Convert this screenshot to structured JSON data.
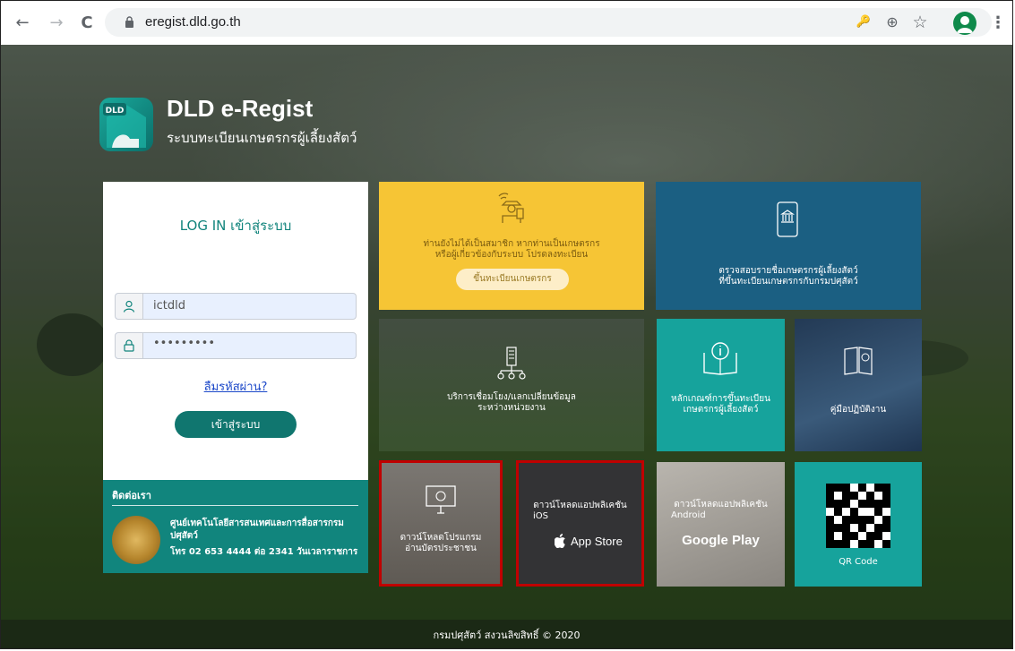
{
  "browser": {
    "url": "eregist.dld.go.th",
    "back_icon": "←",
    "forward_icon": "→",
    "reload_icon": "C",
    "key_icon": "🔑",
    "zoom_icon": "⊕",
    "star_icon": "☆",
    "menu_icon": "⋮"
  },
  "brand": {
    "title": "DLD e-Regist",
    "subtitle": "ระบบทะเบียนเกษตรกรผู้เลี้ยงสัตว์",
    "logo_text": "DLD"
  },
  "login": {
    "title": "LOG IN เข้าสู่ระบบ",
    "username_value": "ictdld",
    "password_value": "•••••••••",
    "forgot_label": "ลืมรหัสผ่าน?",
    "submit_label": "เข้าสู่ระบบ"
  },
  "contact": {
    "title": "ติดต่อเรา",
    "org": "ศูนย์เทคโนโลยีสารสนเทศและการสื่อสารกรมปศุสัตว์",
    "tel": "โทร 02 653 4444 ต่อ 2341 วันเวลาราชการ"
  },
  "tiles": {
    "register": {
      "line1": "ท่านยังไม่ได้เป็นสมาชิก หากท่านเป็นเกษตรกร",
      "line2": "หรือผู้เกี่ยวข้องกับระบบ โปรดลงทะเบียน",
      "button": "ขึ้นทะเบียนเกษตรกร"
    },
    "check": {
      "line1": "ตรวจสอบรายชื่อเกษตรกรผู้เลี้ยงสัตว์",
      "line2": "ที่ขึ้นทะเบียนเกษตรกรกับกรมปศุสัตว์"
    },
    "exchange": {
      "line1": "บริการเชื่อมโยง/แลกเปลี่ยนข้อมูล",
      "line2": "ระหว่างหน่วยงาน"
    },
    "criteria": {
      "line1": "หลักเกณฑ์การขึ้นทะเบียน",
      "line2": "เกษตรกรผู้เลี้ยงสัตว์"
    },
    "manual": {
      "line1": "คู่มือปฏิบัติงาน"
    },
    "card_reader": {
      "line1": "ดาวน์โหลดโปรแกรม",
      "line2": "อ่านบัตรประชาชน"
    },
    "ios": {
      "line1": "ดาวน์โหลดแอปพลิเคชัน",
      "line2": "iOS",
      "store": "App Store"
    },
    "android": {
      "line1": "ดาวน์โหลดแอปพลิเคชัน",
      "line2": "Android",
      "store": "Google Play"
    },
    "qr": {
      "label": "QR Code"
    }
  },
  "footer": {
    "text": "กรมปศุสัตว์ สงวนลิขสิทธิ์ © 2020"
  },
  "colors": {
    "teal": "#11857d",
    "yellow": "#f6c535",
    "blue": "#1b5f82",
    "highlight_border": "#c00000"
  }
}
